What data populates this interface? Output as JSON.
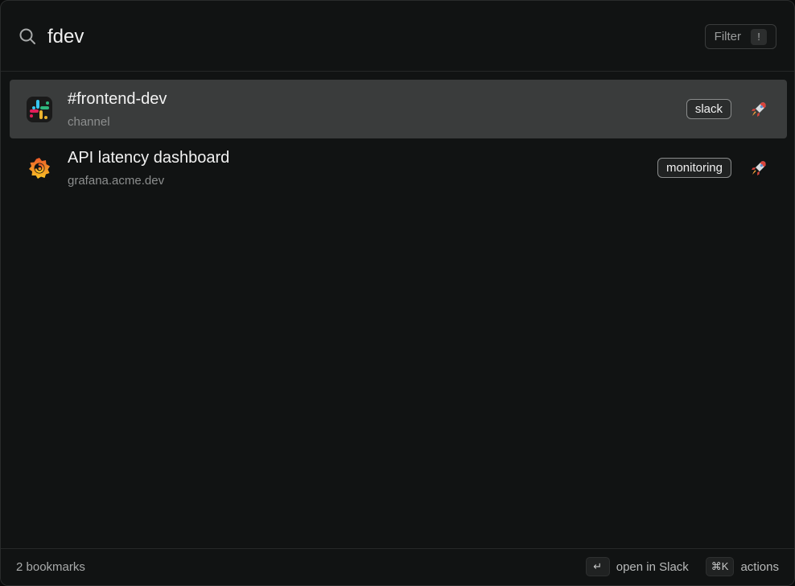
{
  "search": {
    "query": "fdev",
    "icon": "search-icon"
  },
  "filter": {
    "label": "Filter",
    "shortcut": "!"
  },
  "results": [
    {
      "title": "#frontend-dev",
      "subtitle": "channel",
      "tag": "slack",
      "icon": "slack-icon",
      "selected": true
    },
    {
      "title": "API latency dashboard",
      "subtitle": "grafana.acme.dev",
      "tag": "monitoring",
      "icon": "grafana-icon",
      "selected": false
    }
  ],
  "footer": {
    "count": "2 bookmarks",
    "primary_key": "↵",
    "primary_label": "open in Slack",
    "actions_key": "⌘K",
    "actions_label": "actions"
  },
  "colors": {
    "background": "#111313",
    "selected_row": "#3a3c3c",
    "text": "#f2f2f2",
    "muted": "#8c8e8e"
  }
}
